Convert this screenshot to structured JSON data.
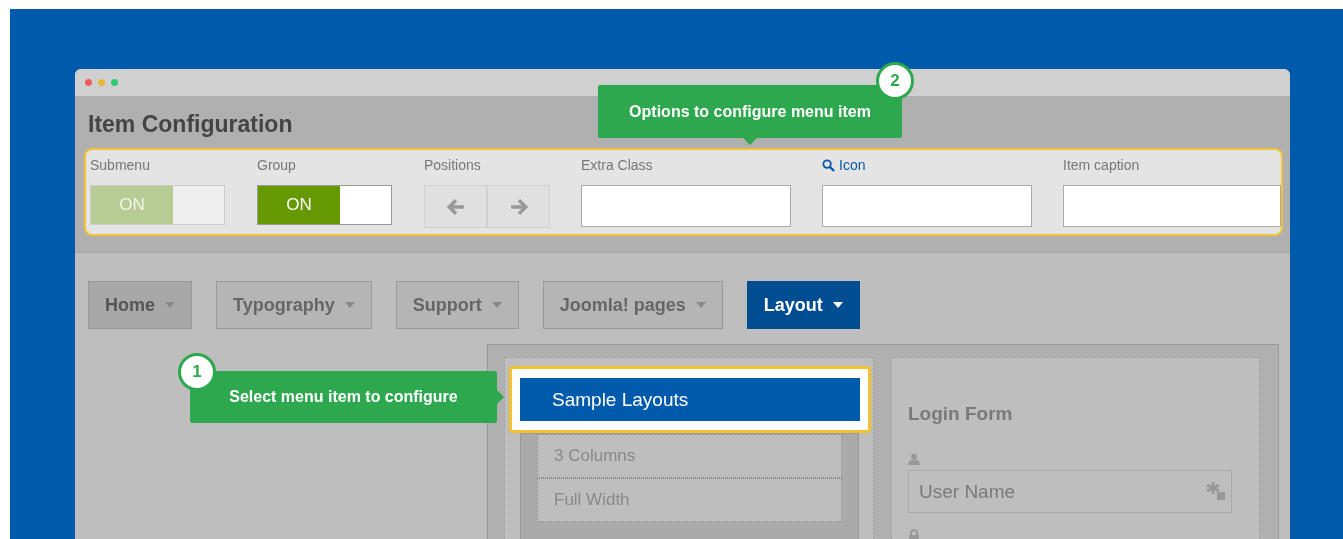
{
  "window": {
    "title": "Item Configuration"
  },
  "config_fields": [
    {
      "kind": "toggle",
      "label": "Submenu",
      "value": "ON",
      "on": true,
      "disabled": true
    },
    {
      "kind": "toggle",
      "label": "Group",
      "value": "ON",
      "on": true,
      "disabled": false
    },
    {
      "kind": "arrows",
      "label": "Positions"
    },
    {
      "kind": "input",
      "label": "Extra Class"
    },
    {
      "kind": "icon_input",
      "label": "Icon"
    },
    {
      "kind": "input",
      "label": "Item caption"
    }
  ],
  "menu": [
    {
      "label": "Home",
      "selected": false
    },
    {
      "label": "Typography",
      "selected": false
    },
    {
      "label": "Support",
      "selected": false
    },
    {
      "label": "Joomla! pages",
      "selected": false
    },
    {
      "label": "Layout",
      "selected": true
    }
  ],
  "dropdown": {
    "title": "Sample Layouts",
    "items": [
      "3 Columns",
      "Full Width"
    ]
  },
  "login": {
    "title": "Login Form",
    "username_placeholder": "User Name"
  },
  "callouts": [
    {
      "number": "1",
      "text": "Select menu item to configure"
    },
    {
      "number": "2",
      "text": "Options to configure menu item"
    }
  ]
}
